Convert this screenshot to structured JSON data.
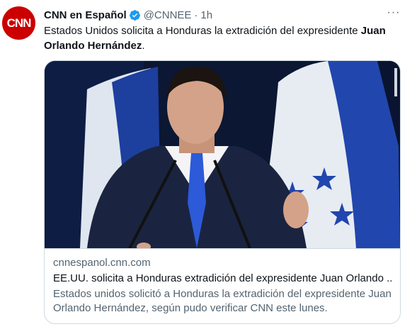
{
  "tweet": {
    "author_name": "CNN en Español",
    "author_handle": "@CNNEE",
    "separator": "·",
    "time": "1h",
    "avatar_logo_text": "CNN",
    "text_plain": "Estados Unidos solicita a Honduras la extradición del expresidente ",
    "text_bold": "Juan Orlando Hernández",
    "text_end": ".",
    "more_icon": "more-horizontal-icon"
  },
  "card": {
    "domain": "cnnespanol.cnn.com",
    "title": "EE.UU. solicita a Honduras extradición del expresidente Juan Orlando ...",
    "description": "Estados unidos solicitó a Honduras la extradición del expresidente Juan Orlando Hernández, según pudo verificar CNN este lunes."
  },
  "colors": {
    "text_primary": "#0f1419",
    "text_secondary": "#536471",
    "verified_blue": "#1d9bf0",
    "border": "#cfd9de",
    "brand_red": "#cc0000"
  }
}
